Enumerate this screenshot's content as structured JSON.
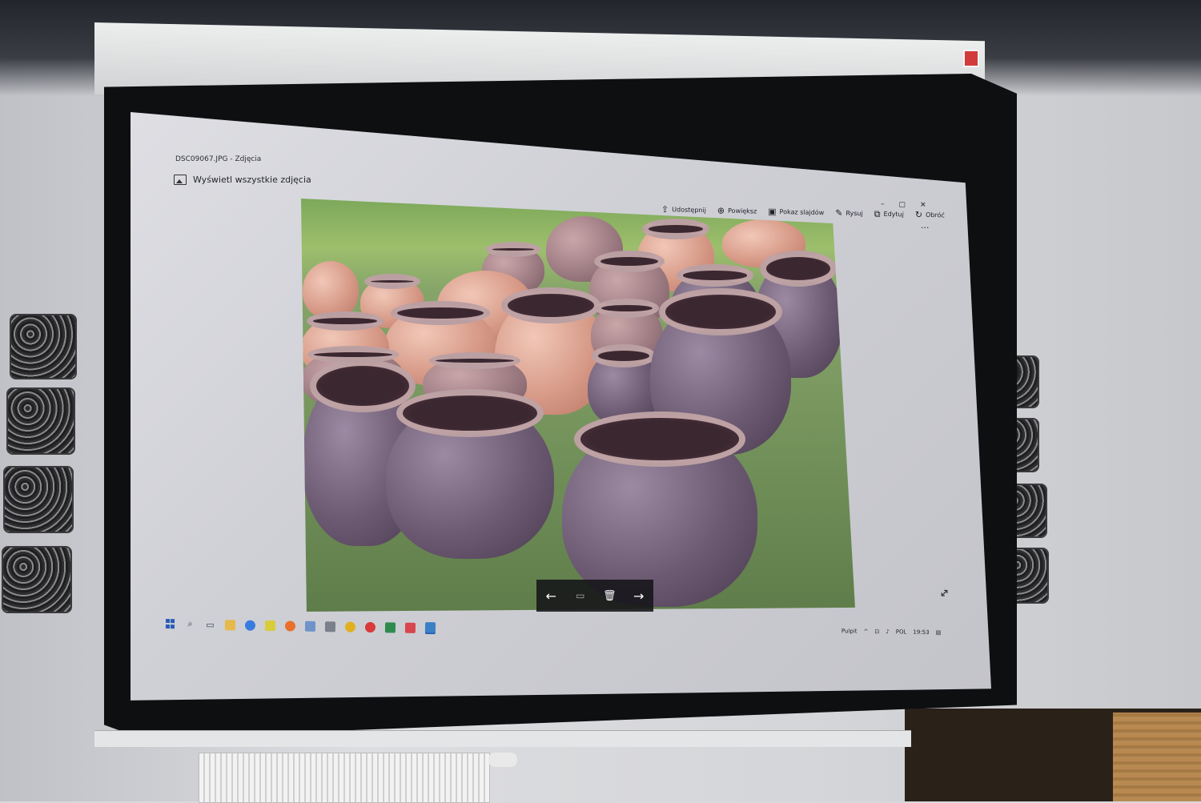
{
  "window": {
    "title": "DSC09067.JPG - Zdjęcia",
    "view_all_label": "Wyświetl wszystkie zdjęcia"
  },
  "toolbar": {
    "items": [
      {
        "label": "Udostępnij",
        "icon": "share-icon"
      },
      {
        "label": "Powiększ",
        "icon": "zoom-icon"
      },
      {
        "label": "Pokaz slajdów",
        "icon": "slideshow-icon"
      },
      {
        "label": "Rysuj",
        "icon": "draw-icon"
      },
      {
        "label": "Edytuj",
        "icon": "edit-icon"
      },
      {
        "label": "Obróć",
        "icon": "rotate-icon"
      }
    ],
    "more_label": "..."
  },
  "window_controls": {
    "minimize": "–",
    "maximize": "▢",
    "close": "✕"
  },
  "nav_bar": {
    "prev": "←",
    "info": "▭",
    "delete": "🗑",
    "next": "→"
  },
  "fullscreen_glyph": "↔",
  "taskbar": {
    "apps": [
      "start",
      "search",
      "task-view",
      "file-explorer",
      "chrome",
      "media-player",
      "firefox",
      "mail",
      "camera",
      "chrome-2",
      "opera",
      "excel",
      "paint",
      "photos"
    ],
    "tray": {
      "desktop_label": "Pulpit",
      "chevron": "^",
      "language": "POL",
      "time": "19:53"
    }
  },
  "colors": {
    "accent": "#2a5bb5",
    "screen_bg": "#d2d3d8",
    "nav_bg": "#141418"
  }
}
